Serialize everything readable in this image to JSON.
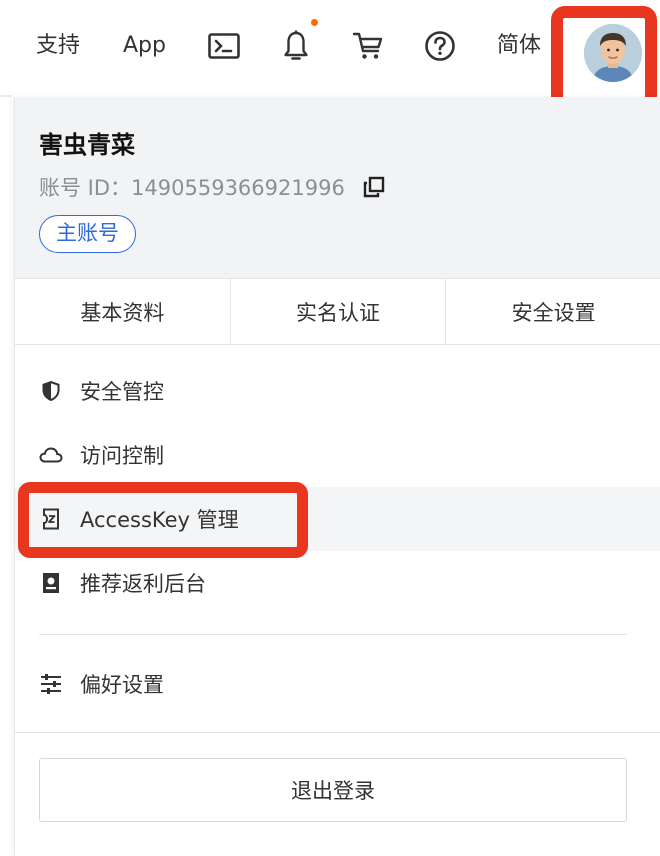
{
  "topnav": {
    "support_label": "支持",
    "app_label": "App",
    "lang_label": "简体",
    "icons": [
      "terminal-icon",
      "bell-icon",
      "cart-icon",
      "help-icon"
    ],
    "notification_dot_color": "#ff6a00"
  },
  "profile": {
    "username": "害虫青菜",
    "account_id": "账号 ID：1490559366921996",
    "badge": "主账号"
  },
  "tabs": [
    {
      "label": "基本资料"
    },
    {
      "label": "实名认证"
    },
    {
      "label": "安全设置"
    }
  ],
  "menu": [
    {
      "label": "安全管控",
      "icon": "shield-icon"
    },
    {
      "label": "访问控制",
      "icon": "cloud-icon"
    },
    {
      "label": "AccessKey 管理",
      "icon": "key-icon"
    },
    {
      "label": "推荐返利后台",
      "icon": "rebate-icon"
    }
  ],
  "preferences": {
    "label": "偏好设置",
    "icon": "sliders-icon"
  },
  "logout_label": "退出登录",
  "colors": {
    "highlight": "#e8361f",
    "accent": "#2f6bd8",
    "profile_bg": "#f2f3f5"
  }
}
